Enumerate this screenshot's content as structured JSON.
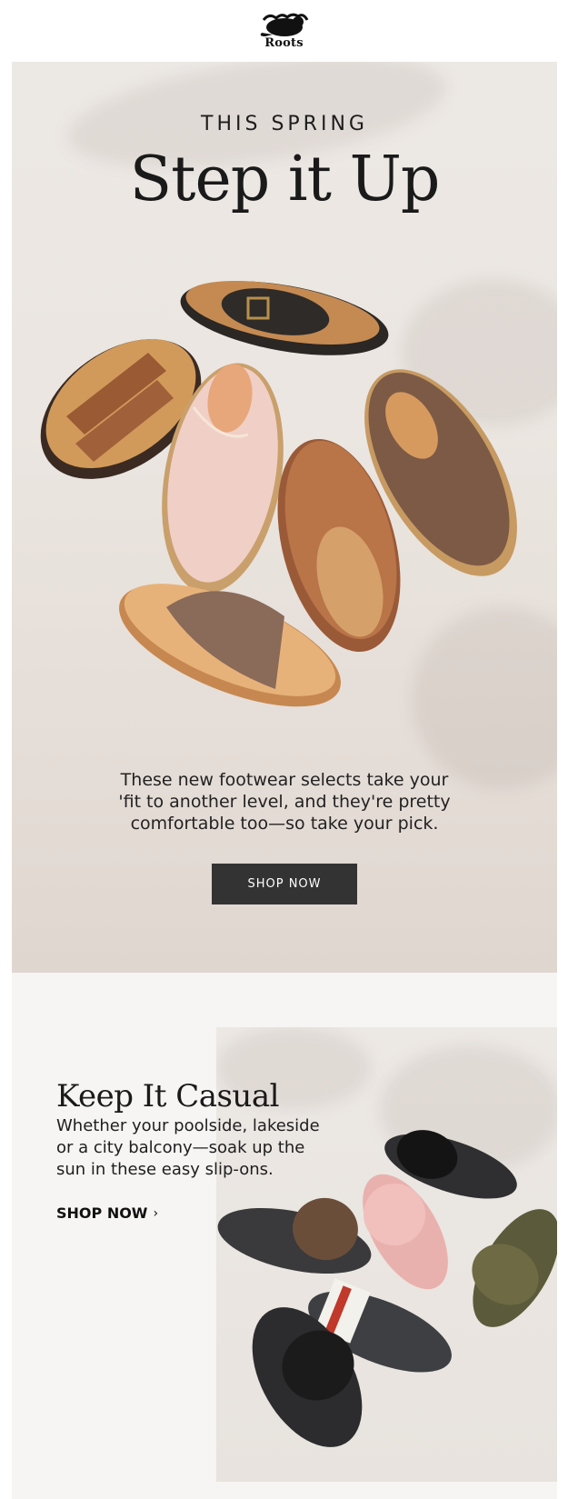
{
  "brand": {
    "name": "Roots",
    "logo_icon": "beaver-logo-icon"
  },
  "hero": {
    "eyebrow": "THIS SPRING",
    "title": "Step it Up",
    "copy_line1": "These new footwear selects take your",
    "copy_line2": "'fit to another level, and they're pretty",
    "copy_line3": "comfortable too—so take your pick.",
    "cta": "SHOP NOW",
    "image_icon": "footwear-collection-image"
  },
  "casual": {
    "title": "Keep It Casual",
    "copy_line1": "Whether your poolside, lakeside",
    "copy_line2": "or a city balcony—soak up the",
    "copy_line3": "sun in these easy slip-ons.",
    "cta": "SHOP NOW",
    "cta_icon": "chevron-right-icon",
    "image_icon": "slide-sandals-image"
  },
  "colors": {
    "button_bg": "#333333",
    "text": "#1a1a1a",
    "hero_bg": "#ebe6e1",
    "section_bg": "#f6f5f3"
  }
}
